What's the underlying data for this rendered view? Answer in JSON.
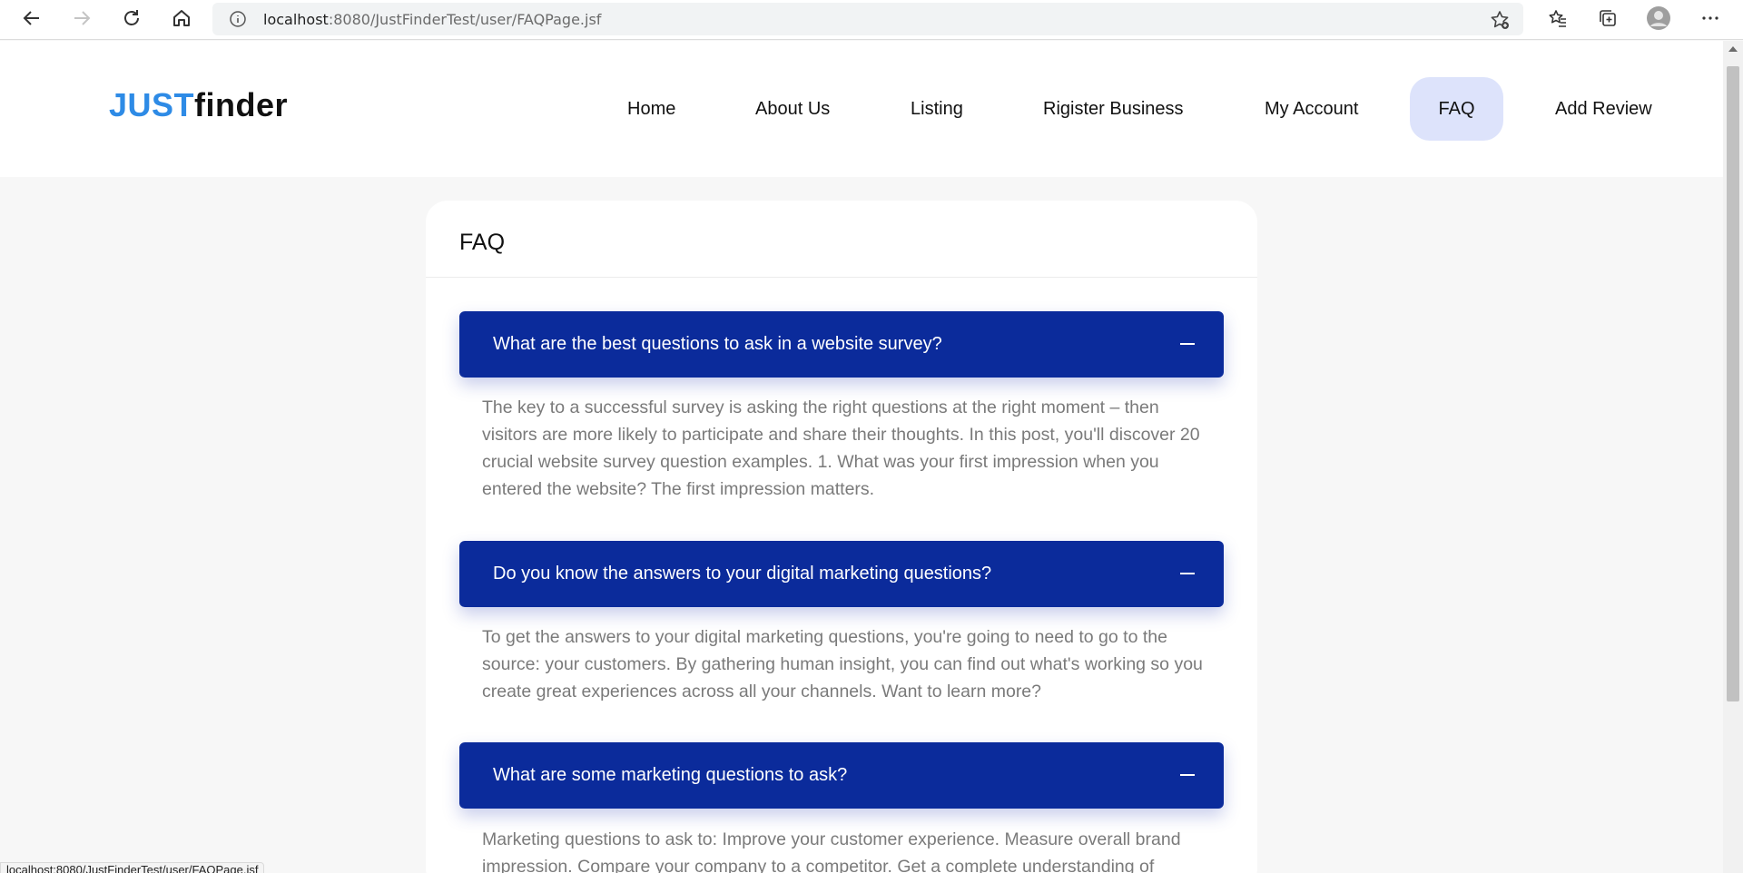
{
  "browser": {
    "url_host": "localhost",
    "url_rest": ":8080/JustFinderTest/user/FAQPage.jsf",
    "status_url": "localhost:8080/JustFinderTest/user/FAQPage.jsf"
  },
  "site": {
    "logo_part1": "JUST",
    "logo_part2": "finder",
    "nav": [
      {
        "label": "Home"
      },
      {
        "label": "About Us"
      },
      {
        "label": "Listing"
      },
      {
        "label": "Rigister Business"
      },
      {
        "label": "My Account"
      },
      {
        "label": "FAQ",
        "active": true
      },
      {
        "label": "Add Review"
      }
    ]
  },
  "faq": {
    "title": "FAQ",
    "items": [
      {
        "question": "What are the best questions to ask in a website survey?",
        "answer": "The key to a successful survey is asking the right questions at the right moment – then visitors are more likely to participate and share their thoughts. In this post, you'll discover 20 crucial website survey question examples. 1. What was your first impression when you entered the website? The first impression matters."
      },
      {
        "question": "Do you know the answers to your digital marketing questions?",
        "answer": "To get the answers to your digital marketing questions, you're going to need to go to the source: your customers. By gathering human insight, you can find out what's working so you create great experiences across all your channels. Want to learn more?"
      },
      {
        "question": "What are some marketing questions to ask?",
        "answer": "Marketing questions to ask to: Improve your customer experience. Measure overall brand impression. Compare your company to a competitor. Get a complete understanding of"
      }
    ]
  },
  "colors": {
    "accent": "#0b2b9b",
    "active_nav": "#dde3fb",
    "logo_blue": "#2e8be6"
  }
}
